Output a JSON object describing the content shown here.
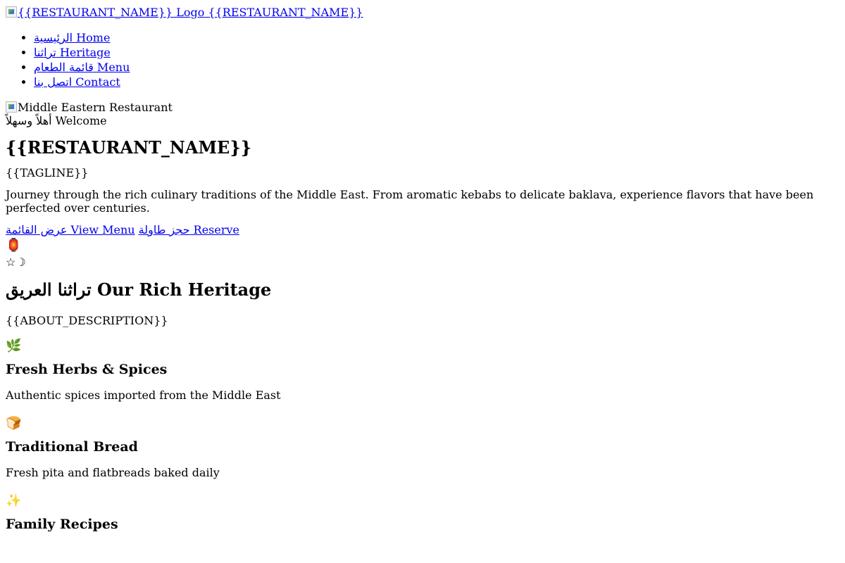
{
  "header": {
    "logo_alt": "{{RESTAURANT_NAME}} Logo",
    "logo_text": "{{RESTAURANT_NAME}}"
  },
  "nav": {
    "items": [
      {
        "label": "الرئيسية Home"
      },
      {
        "label": "تراثنا Heritage"
      },
      {
        "label": "قائمة الطعام Menu"
      },
      {
        "label": "اتصل بنا Contact"
      }
    ]
  },
  "hero": {
    "image_alt": "Middle Eastern Restaurant",
    "welcome": "أهلاً وسهلاً Welcome",
    "title": "{{RESTAURANT_NAME}}",
    "tagline": "{{TAGLINE}}",
    "description": "Journey through the rich culinary traditions of the Middle East. From aromatic kebabs to delicate baklava, experience flavors that have been perfected over centuries.",
    "view_menu_label": "عرض القائمة View Menu",
    "reserve_label": "حجز طاولة Reserve"
  },
  "ornaments": {
    "lantern": "🏮",
    "star_moon": "☆☽"
  },
  "about": {
    "title": "تراثنا العريق Our Rich Heritage",
    "description": "{{ABOUT_DESCRIPTION}}"
  },
  "features": [
    {
      "icon": "🌿",
      "icon_name": "herb-icon",
      "title": "Fresh Herbs & Spices",
      "desc": "Authentic spices imported from the Middle East"
    },
    {
      "icon": "🍞",
      "icon_name": "bread-icon",
      "title": "Traditional Bread",
      "desc": "Fresh pita and flatbreads baked daily"
    },
    {
      "icon": "✨",
      "icon_name": "sparkles-icon",
      "title": "Family Recipes",
      "desc": ""
    }
  ],
  "colors": {
    "link": "#0000ee",
    "text": "#000000",
    "background": "#ffffff"
  }
}
